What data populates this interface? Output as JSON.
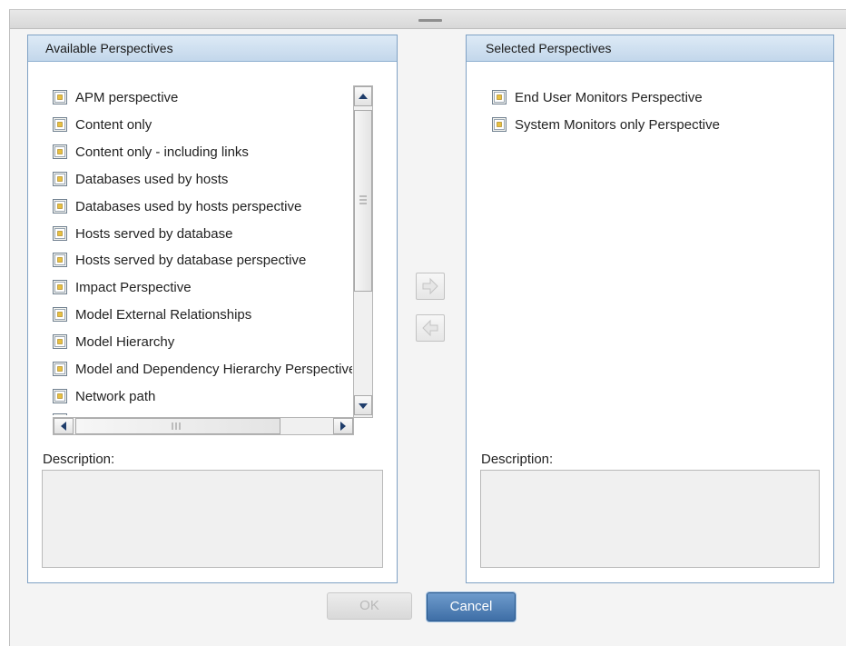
{
  "available": {
    "title": "Available Perspectives",
    "items": [
      {
        "label": "APM perspective"
      },
      {
        "label": "Content only"
      },
      {
        "label": "Content only - including links"
      },
      {
        "label": "Databases used by hosts"
      },
      {
        "label": "Databases used by hosts perspective"
      },
      {
        "label": "Hosts served by database"
      },
      {
        "label": "Hosts served by database perspective"
      },
      {
        "label": "Impact Perspective"
      },
      {
        "label": "Model External Relationships"
      },
      {
        "label": "Model Hierarchy"
      },
      {
        "label": "Model and Dependency Hierarchy Perspective"
      },
      {
        "label": "Network path"
      }
    ],
    "description_label": "Description:"
  },
  "selected": {
    "title": "Selected Perspectives",
    "items": [
      {
        "label": "End User Monitors Perspective"
      },
      {
        "label": "System Monitors only Perspective"
      }
    ],
    "description_label": "Description:"
  },
  "buttons": {
    "move_right_icon": "arrow-right-icon",
    "move_left_icon": "arrow-left-icon",
    "ok_label": "OK",
    "cancel_label": "Cancel"
  },
  "colors": {
    "panel_border": "#7fa1c4",
    "header_bg": "#c3d7eb",
    "cancel_bg": "#4a7bb5",
    "icon_yellow": "#e8c040"
  }
}
